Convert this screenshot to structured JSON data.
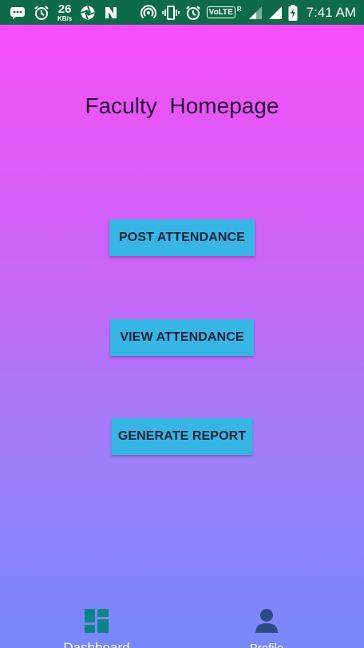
{
  "status_bar": {
    "speed_value": "26",
    "speed_unit": "KB/s",
    "volte": "VoLTE",
    "volte_sup": "R",
    "time": "7:41 AM",
    "icons": [
      "message-icon",
      "alarm-icon",
      "data-speed",
      "aperture-icon",
      "n-icon",
      "hotspot-icon",
      "vibrate-icon",
      "alarm-icon",
      "volte-badge",
      "signal-icon",
      "signal-icon",
      "battery-charging-icon"
    ]
  },
  "page": {
    "title": "Faculty  Homepage",
    "gradient_top": "#f84ef9",
    "gradient_bottom": "#7688fa"
  },
  "buttons": {
    "post": "POST ATTENDANCE",
    "view": "VIEW ATTENDANCE",
    "report": "GENERATE REPORT",
    "color": "#37b5e4"
  },
  "bottom_nav": {
    "dashboard": {
      "label": "Dashboard",
      "icon": "dashboard-icon",
      "icon_color": "#0b8585"
    },
    "profile": {
      "label": "Profile",
      "icon": "person-icon",
      "icon_color": "#2e4a84"
    }
  }
}
